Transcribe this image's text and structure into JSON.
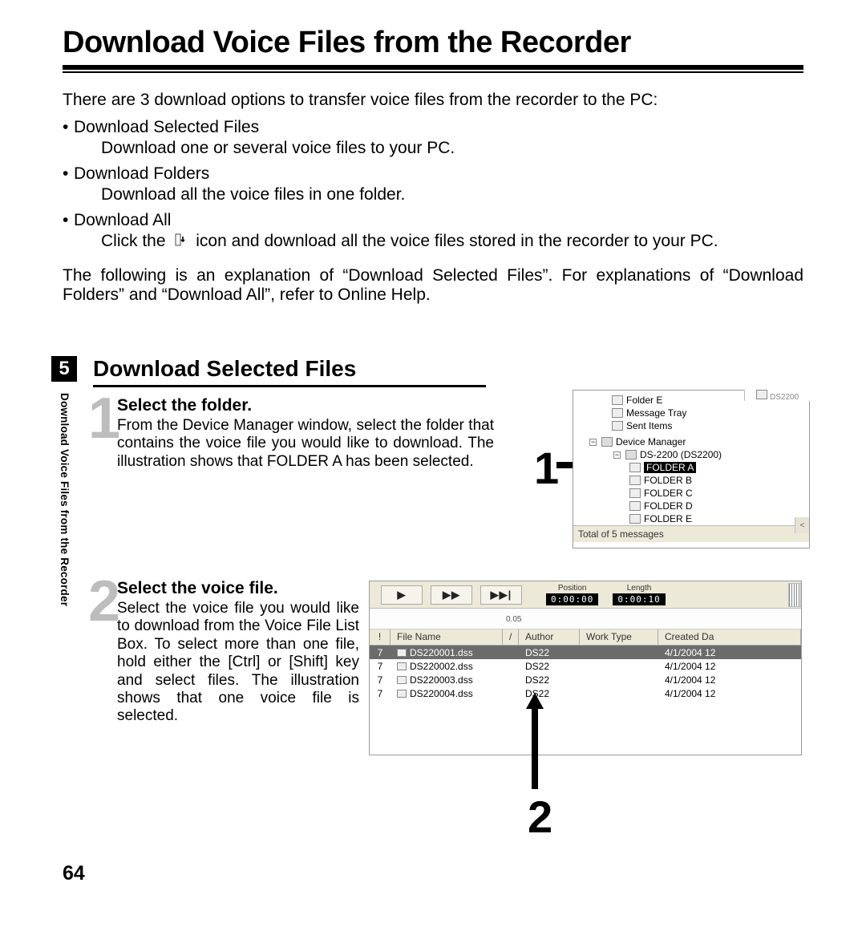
{
  "title": "Download Voice Files from the Recorder",
  "intro": "There are 3 download options to transfer voice files from the recorder to the PC:",
  "bullets": {
    "b1_title": "Download Selected Files",
    "b1_desc": "Download one or several voice files to your PC.",
    "b2_title": "Download Folders",
    "b2_desc": "Download all the voice files in one folder.",
    "b3_title": "Download All",
    "b3_desc_pre": "Click the",
    "b3_desc_post": "icon and download all the voice files stored in the recorder to your PC."
  },
  "explain": "The following is an explanation of “Download Selected Files”. For explanations of “Download Folders” and “Download All”, refer to Online Help.",
  "chapter_num": "5",
  "side_label": "Download Voice Files from the Recorder",
  "section_heading": "Download Selected Files",
  "step1": {
    "num": "1",
    "title": "Select the folder.",
    "body": "From the Device Manager window, select the folder that contains the voice file you would like to download. The illustration shows that FOLDER A has been selected."
  },
  "step2": {
    "num": "2",
    "title": "Select the voice file.",
    "body": "Select the voice file you would like to download from the Voice File List Box. To select more than one file, hold either the [Ctrl] or [Shift] key and select files. The illustration shows that one voice file is selected."
  },
  "callout1": "1",
  "callout2": "2",
  "shot1": {
    "overflow_file": "DS2200",
    "items_top": [
      "Folder E",
      "Message Tray",
      "Sent Items"
    ],
    "device_manager": "Device Manager",
    "device": "DS-2200 (DS2200)",
    "folders": [
      "FOLDER A",
      "FOLDER B",
      "FOLDER C",
      "FOLDER D",
      "FOLDER E"
    ],
    "status": "Total of 5 messages"
  },
  "shot2": {
    "position_label": "Position",
    "position_val": "0:00:00",
    "length_label": "Length",
    "length_val": "0:00:10",
    "ruler_tick": "0.05",
    "headers": {
      "excl": "!",
      "file": "File Name",
      "sort": "/",
      "author": "Author",
      "work": "Work Type",
      "created": "Created Da"
    },
    "rows": [
      {
        "p": "7",
        "fn": "DS220001.dss",
        "au": "DS22",
        "wt": "",
        "cd": "4/1/2004 12"
      },
      {
        "p": "7",
        "fn": "DS220002.dss",
        "au": "DS22",
        "wt": "",
        "cd": "4/1/2004 12"
      },
      {
        "p": "7",
        "fn": "DS220003.dss",
        "au": "DS22",
        "wt": "",
        "cd": "4/1/2004 12"
      },
      {
        "p": "7",
        "fn": "DS220004.dss",
        "au": "DS22",
        "wt": "",
        "cd": "4/1/2004 12"
      }
    ]
  },
  "page_number": "64"
}
